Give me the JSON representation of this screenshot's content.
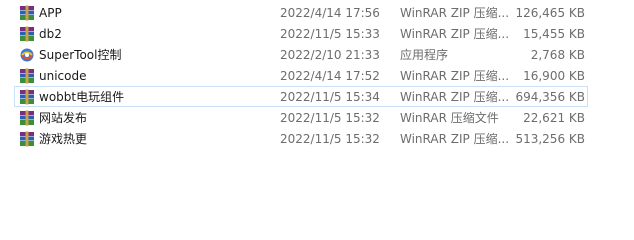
{
  "files": [
    {
      "name": "APP",
      "modified": "2022/4/14 17:56",
      "type": "WinRAR ZIP 压缩...",
      "size": "126,465 KB",
      "icon": "winrar-zip-icon"
    },
    {
      "name": "db2",
      "modified": "2022/11/5 15:33",
      "type": "WinRAR ZIP 压缩...",
      "size": "15,455 KB",
      "icon": "winrar-zip-icon"
    },
    {
      "name": "SuperTool控制",
      "modified": "2022/2/10 21:33",
      "type": "应用程序",
      "size": "2,768 KB",
      "icon": "application-icon"
    },
    {
      "name": "unicode",
      "modified": "2022/4/14 17:52",
      "type": "WinRAR ZIP 压缩...",
      "size": "16,900 KB",
      "icon": "winrar-zip-icon"
    },
    {
      "name": "wobbt电玩组件",
      "modified": "2022/11/5 15:34",
      "type": "WinRAR ZIP 压缩...",
      "size": "694,356 KB",
      "icon": "winrar-zip-icon"
    },
    {
      "name": "网站发布",
      "modified": "2022/11/5 15:32",
      "type": "WinRAR 压缩文件",
      "size": "22,621 KB",
      "icon": "winrar-archive-icon"
    },
    {
      "name": "游戏热更",
      "modified": "2022/11/5 15:32",
      "type": "WinRAR ZIP 压缩...",
      "size": "513,256 KB",
      "icon": "winrar-zip-icon"
    }
  ]
}
